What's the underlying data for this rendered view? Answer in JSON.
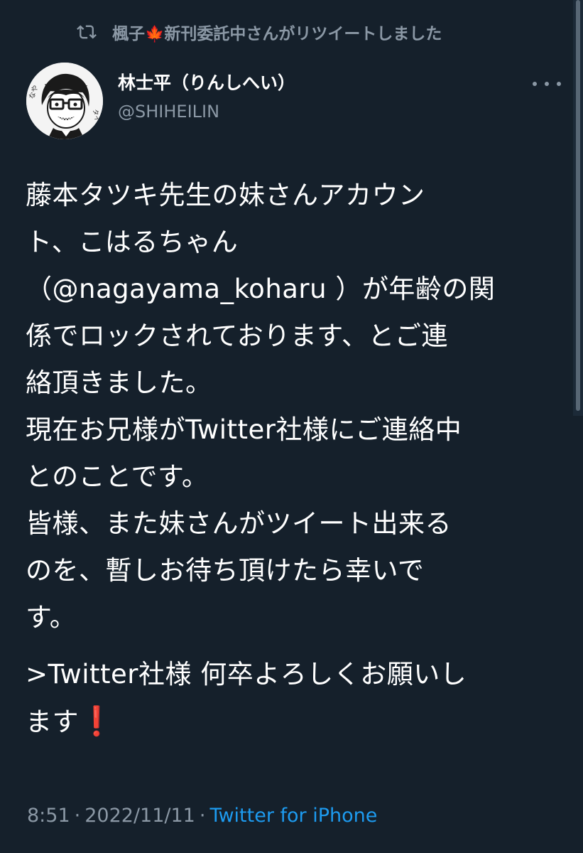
{
  "retweet": {
    "icon": "retweet-icon",
    "text_before": "楓子",
    "leaf_emoji": "🍁",
    "text_after": "新刊委託中さんがリツイートしました"
  },
  "author": {
    "avatar_icon": "avatar-illustration",
    "name": "林士平（りんしへい）",
    "handle": "@SHIHEILIN"
  },
  "more_icon": "more-horizontal-icon",
  "tweet": {
    "lines": [
      "藤本タツキ先生の妹さんアカウン",
      "ト、こはるちゃん",
      "（@nagayama_koharu ）が年齢の関",
      "係でロックされております、とご連",
      "絡頂きました。",
      "現在お兄様がTwitter社様にご連絡中",
      "とのことです。",
      "皆様、また妹さんがツイート出来る",
      "のを、暫しお待ち頂けたら幸いで",
      "す。"
    ],
    "closing_line1": ">Twitter社様 何卒よろしくお願いし",
    "closing_line2": "ます",
    "closing_emoji": "❗"
  },
  "meta": {
    "time": "8:51",
    "separator": "·",
    "date": "2022/11/11",
    "source": "Twitter for iPhone"
  },
  "colors": {
    "background": "#15202b",
    "secondary_text": "#8b98a5",
    "link": "#1d9bf0"
  }
}
